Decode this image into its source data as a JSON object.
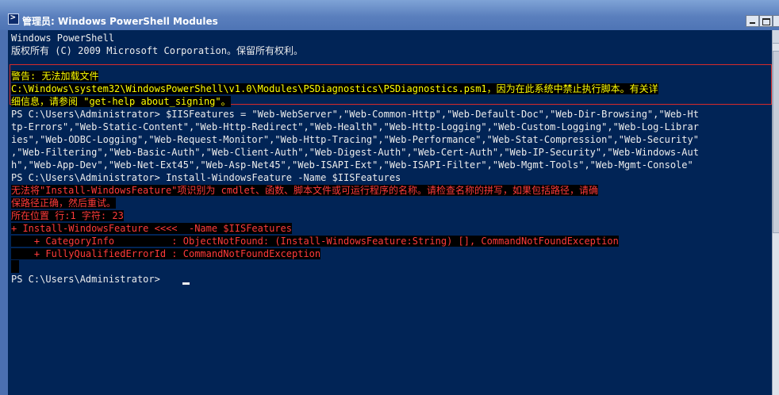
{
  "window": {
    "title": "管理员: Windows PowerShell Modules"
  },
  "console": {
    "lines": [
      {
        "text": "Windows PowerShell",
        "type": "normal"
      },
      {
        "text": "版权所有 (C) 2009 Microsoft Corporation。保留所有权利。",
        "type": "normal"
      },
      {
        "text": "",
        "type": "normal"
      },
      {
        "text": "警告: 无法加载文件",
        "type": "warn"
      },
      {
        "text": "C:\\Windows\\system32\\WindowsPowerShell\\v1.0\\Modules\\PSDiagnostics\\PSDiagnostics.psm1，因为在此系统中禁止执行脚本。有关详",
        "type": "warn"
      },
      {
        "text": "细信息，请参阅 \"get-help about_signing\"。",
        "type": "warn"
      },
      {
        "text": "PS C:\\Users\\Administrator> $IISFeatures = \"Web-WebServer\",\"Web-Common-Http\",\"Web-Default-Doc\",\"Web-Dir-Browsing\",\"Web-Ht",
        "type": "normal"
      },
      {
        "text": "tp-Errors\",\"Web-Static-Content\",\"Web-Http-Redirect\",\"Web-Health\",\"Web-Http-Logging\",\"Web-Custom-Logging\",\"Web-Log-Librar",
        "type": "normal"
      },
      {
        "text": "ies\",\"Web-ODBC-Logging\",\"Web-Request-Monitor\",\"Web-Http-Tracing\",\"Web-Performance\",\"Web-Stat-Compression\",\"Web-Security\"",
        "type": "normal"
      },
      {
        "text": ",\"Web-Filtering\",\"Web-Basic-Auth\",\"Web-Client-Auth\",\"Web-Digest-Auth\",\"Web-Cert-Auth\",\"Web-IP-Security\",\"Web-Windows-Aut",
        "type": "normal"
      },
      {
        "text": "h\",\"Web-App-Dev\",\"Web-Net-Ext45\",\"Web-Asp-Net45\",\"Web-ISAPI-Ext\",\"Web-ISAPI-Filter\",\"Web-Mgmt-Tools\",\"Web-Mgmt-Console\"",
        "type": "normal"
      },
      {
        "text": "PS C:\\Users\\Administrator> Install-WindowsFeature -Name $IISFeatures",
        "type": "normal"
      },
      {
        "text": "无法将\"Install-WindowsFeature\"项识别为 cmdlet、函数、脚本文件或可运行程序的名称。请检查名称的拼写，如果包括路径，请确",
        "type": "err"
      },
      {
        "text": "保路径正确，然后重试。",
        "type": "err"
      },
      {
        "text": "所在位置 行:1 字符: 23",
        "type": "err"
      },
      {
        "text": "+ Install-WindowsFeature <<<<  -Name $IISFeatures",
        "type": "err"
      },
      {
        "text": "    + CategoryInfo          : ObjectNotFound: (Install-WindowsFeature:String) [], CommandNotFoundException",
        "type": "err"
      },
      {
        "text": "    + FullyQualifiedErrorId : CommandNotFoundException",
        "type": "err"
      },
      {
        "text": "",
        "type": "normal"
      },
      {
        "text": "PS C:\\Users\\Administrator> ",
        "type": "normal"
      }
    ]
  },
  "colors": {
    "console_bg": "#012456",
    "text": "#ededed",
    "warning": "#ffff00",
    "error": "#ff3b3b"
  },
  "icons": [
    "powershell-icon",
    "minimize-icon",
    "maximize-icon"
  ]
}
